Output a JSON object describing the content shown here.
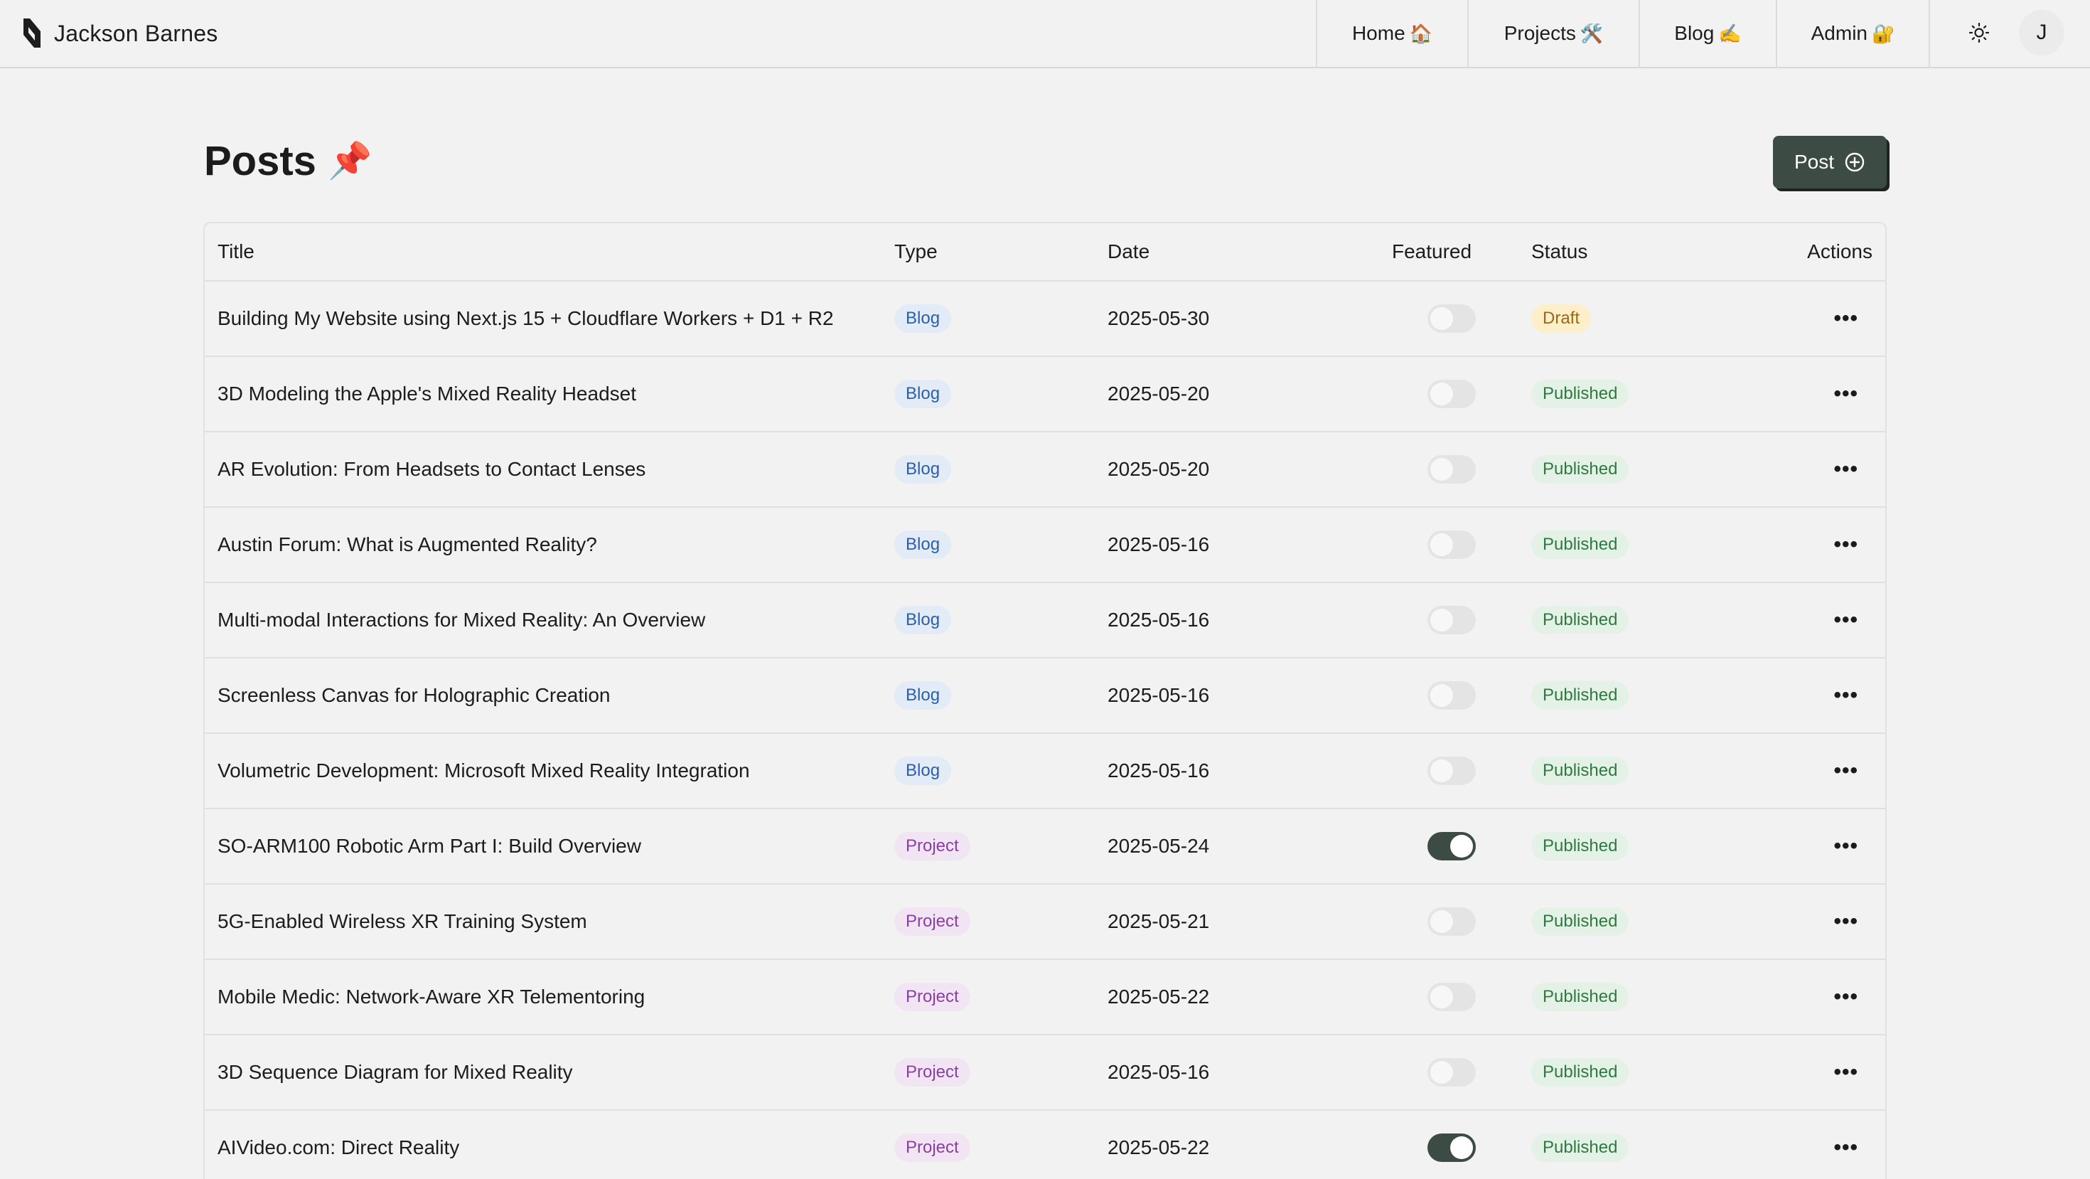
{
  "header": {
    "brand_name": "Jackson Barnes",
    "nav": [
      {
        "label": "Home",
        "emoji": "🏠"
      },
      {
        "label": "Projects",
        "emoji": "🛠️"
      },
      {
        "label": "Blog",
        "emoji": "✍️"
      },
      {
        "label": "Admin",
        "emoji": "🔐"
      }
    ],
    "avatar_initial": "J",
    "theme_icon": "sun-icon"
  },
  "page": {
    "title": "Posts",
    "title_emoji": "📌",
    "new_post_label": "Post",
    "new_post_icon": "plus-circle-icon"
  },
  "table": {
    "columns": [
      "Title",
      "Type",
      "Date",
      "Featured",
      "Status",
      "Actions"
    ],
    "rows": [
      {
        "title": "Building My Website using Next.js 15 + Cloudflare Workers + D1 + R2",
        "type": "Blog",
        "date": "2025-05-30",
        "featured": false,
        "status": "Draft"
      },
      {
        "title": "3D Modeling the Apple's Mixed Reality Headset",
        "type": "Blog",
        "date": "2025-05-20",
        "featured": false,
        "status": "Published"
      },
      {
        "title": "AR Evolution: From Headsets to Contact Lenses",
        "type": "Blog",
        "date": "2025-05-20",
        "featured": false,
        "status": "Published"
      },
      {
        "title": "Austin Forum: What is Augmented Reality?",
        "type": "Blog",
        "date": "2025-05-16",
        "featured": false,
        "status": "Published"
      },
      {
        "title": "Multi-modal Interactions for Mixed Reality: An Overview",
        "type": "Blog",
        "date": "2025-05-16",
        "featured": false,
        "status": "Published"
      },
      {
        "title": "Screenless Canvas for Holographic Creation",
        "type": "Blog",
        "date": "2025-05-16",
        "featured": false,
        "status": "Published"
      },
      {
        "title": "Volumetric Development: Microsoft Mixed Reality Integration",
        "type": "Blog",
        "date": "2025-05-16",
        "featured": false,
        "status": "Published"
      },
      {
        "title": "SO-ARM100 Robotic Arm Part I: Build Overview",
        "type": "Project",
        "date": "2025-05-24",
        "featured": true,
        "status": "Published"
      },
      {
        "title": "5G-Enabled Wireless XR Training System",
        "type": "Project",
        "date": "2025-05-21",
        "featured": false,
        "status": "Published"
      },
      {
        "title": "Mobile Medic: Network-Aware XR Telementoring",
        "type": "Project",
        "date": "2025-05-22",
        "featured": false,
        "status": "Published"
      },
      {
        "title": "3D Sequence Diagram for Mixed Reality",
        "type": "Project",
        "date": "2025-05-16",
        "featured": false,
        "status": "Published"
      },
      {
        "title": "AIVideo.com: Direct Reality",
        "type": "Project",
        "date": "2025-05-22",
        "featured": true,
        "status": "Published"
      }
    ],
    "actions_glyph": "•••"
  },
  "colors": {
    "accent": "#3d4b45",
    "background": "#f2f2f2",
    "blog_badge": "#2d5fa8",
    "project_badge": "#8a3ea3",
    "draft": "#9a6a12",
    "published": "#2e7a3e"
  }
}
